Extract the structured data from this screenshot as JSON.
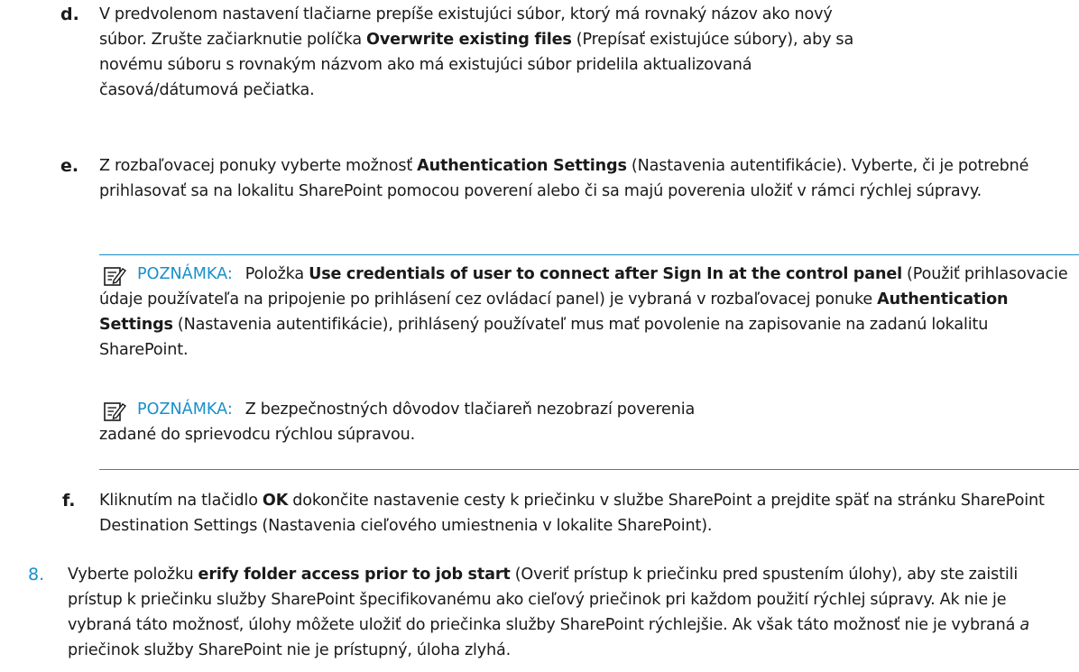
{
  "steps": [
    {
      "marker": "d.",
      "parts": [
        {
          "t": "V predvolenom nastavení tlačiarne prepíše existujúci súbor, ktorý má rovnaký názov ako nový súbor. Zrušte začiarknutie políčka "
        },
        {
          "t": "Overwrite existing files",
          "b": true
        },
        {
          "t": " (Prepísať existujúce súbory), aby sa novému súboru s rovnakým názvom ako má existujúci súbor pridelila aktualizovaná časová/dátumová pečiatka."
        }
      ]
    },
    {
      "marker": "e.",
      "parts": [
        {
          "t": "Z rozbaľovacej ponuky vyberte možnosť "
        },
        {
          "t": "Authentication Settings",
          "b": true
        },
        {
          "t": " (Nastavenia autentifikácie). Vyberte, či je potrebné prihlasovať sa na lokalitu SharePoint pomocou poverení alebo či sa majú poverenia uložiť v rámci rýchlej súpravy."
        }
      ]
    },
    {
      "marker": "f.",
      "parts": [
        {
          "t": "Kliknutím na tlačidlo "
        },
        {
          "t": "OK",
          "b": true
        },
        {
          "t": " dokončite nastavenie cesty k priečinku v službe SharePoint a prejdite späť na stránku SharePoint Destination Settings (Nastavenia cieľového umiestnenia v lokalite SharePoint)."
        }
      ]
    },
    {
      "marker": "8.",
      "parts": [
        {
          "t": "Vyberte položku "
        },
        {
          "t": "erify folder access prior to job start",
          "b": true
        },
        {
          "t": " (Overiť prístup k priečinku pred spustením úlohy), aby ste zaistili prístup k priečinku služby SharePoint špecifikovanému ako cieľový priečinok pri každom použití rýchlej súpravy. Ak nie je vybraná táto možnosť, úlohy môžete uložiť do priečinka služby SharePoint rýchlejšie. Ak však táto možnosť nie je vybraná "
        },
        {
          "t": "a",
          "i": true
        },
        {
          "t": " priečinok služby SharePoint nie je prístupný, úloha zlyhá."
        }
      ]
    }
  ],
  "notes": [
    {
      "label": "POZNÁMKA:",
      "icon": "note-icon",
      "parts": [
        {
          "t": "Položka "
        },
        {
          "t": "Use credentials of user to connect after Sign In at the control panel",
          "b": true
        },
        {
          "t": " (Použiť prihlasovacie údaje používateľa na pripojenie po prihlásení cez ovládací panel) je vybraná v rozbaľovacej ponuke "
        },
        {
          "t": "Authentication Settings",
          "b": true
        },
        {
          "t": " (Nastavenia autentifikácie), prihlásený používateľ mus mať povolenie na zapisovanie na zadanú lokalitu SharePoint."
        }
      ]
    },
    {
      "label": "POZNÁMKA:",
      "icon": "note-icon",
      "parts": [
        {
          "t": "Z bezpečnostných dôvodov tlačiareň nezobrazí poverenia zadané do sprievodcu rýchlou súpravou."
        }
      ]
    }
  ],
  "colors": {
    "accent": "#1a8fc9",
    "text": "#1a1a1a"
  }
}
